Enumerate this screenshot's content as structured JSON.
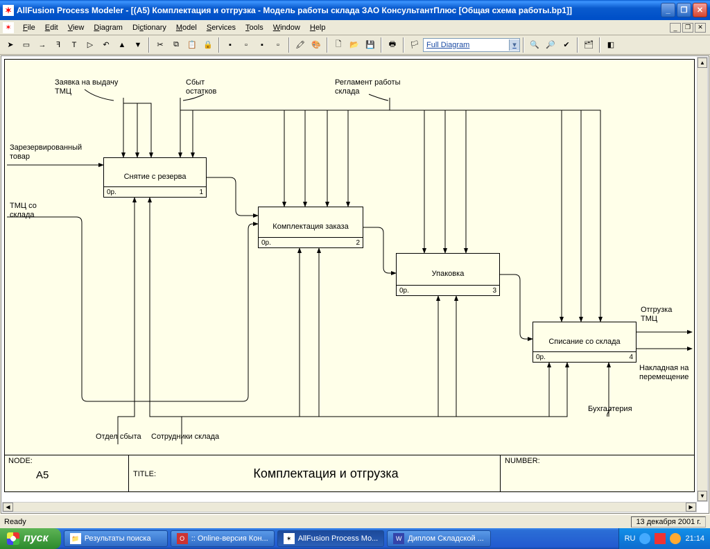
{
  "window": {
    "title": "AllFusion Process Modeler  - [(А5) Комплектация  и отгрузка - Модель работы склада ЗАО КонсультантПлюс  [Общая схема работы.bp1]]"
  },
  "menu": {
    "file": "File",
    "edit": "Edit",
    "view": "View",
    "diagram": "Diagram",
    "dictionary": "Dictionary",
    "model": "Model",
    "services": "Services",
    "tools": "Tools",
    "window": "Window",
    "help": "Help"
  },
  "toolbar": {
    "combo": "Full Diagram"
  },
  "labels": {
    "input1": "Заявка на выдачу\nТМЦ",
    "input2": "Сбыт\nостатков",
    "input3": "Регламент работы\nсклада",
    "left1": "Зарезервированный\nтовар",
    "left2": "ТМЦ со\nсклада",
    "out1": "Отгрузка\nТМЦ",
    "out2": "Накладная на\nперемещение",
    "mech1": "Отдел сбыта",
    "mech2": "Сотрудники склада",
    "mech3": "Бухгалтерия"
  },
  "boxes": {
    "b1": {
      "name": "Снятие с резерва",
      "cost": "0р.",
      "num": "1"
    },
    "b2": {
      "name": "Комплектация заказа",
      "cost": "0р.",
      "num": "2"
    },
    "b3": {
      "name": "Упаковка",
      "cost": "0р.",
      "num": "3"
    },
    "b4": {
      "name": "Списание со склада",
      "cost": "0р.",
      "num": "4"
    }
  },
  "footer": {
    "node_lbl": "NODE:",
    "node_val": "A5",
    "title_lbl": "TITLE:",
    "title_val": "Комплектация  и отгрузка",
    "num_lbl": "NUMBER:"
  },
  "status": {
    "ready": "Ready",
    "date": "13 декабря 2001 г."
  },
  "taskbar": {
    "start": "пуск",
    "t1": "Результаты поиска",
    "t2": ":: Online-версия Кон...",
    "t3": "AllFusion Process Mo...",
    "t4": "Диплом Складской ...",
    "lang": "RU",
    "clock": "21:14"
  }
}
